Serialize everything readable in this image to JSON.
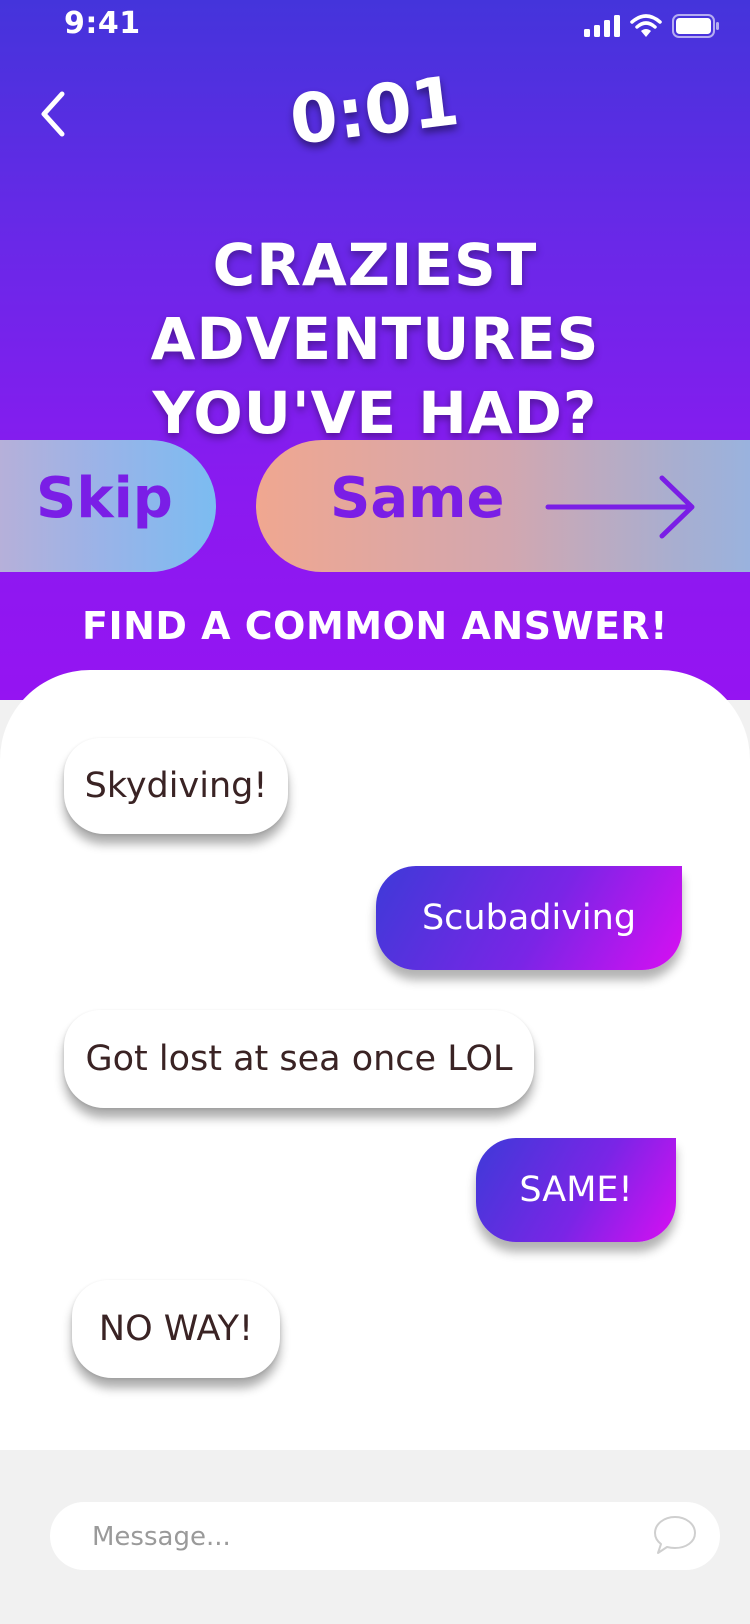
{
  "status_bar": {
    "time": "9:41"
  },
  "timer": "0:01",
  "question": {
    "line1": "CRAZIEST ADVENTURES",
    "line2": "YOU'VE HAD?"
  },
  "actions": {
    "skip": "Skip",
    "same": "Same"
  },
  "hint": "FIND A COMMON ANSWER!",
  "messages": [
    {
      "from": "them",
      "text": "Skydiving!"
    },
    {
      "from": "me",
      "text": "Scubadiving"
    },
    {
      "from": "them",
      "text": "Got lost at sea once LOL"
    },
    {
      "from": "me",
      "text": "SAME!"
    },
    {
      "from": "them",
      "text": "NO WAY!"
    }
  ],
  "composer": {
    "placeholder": "Message..."
  },
  "icons": {
    "back": "chevron-left-icon",
    "arrow": "arrow-right-icon",
    "chat": "chat-bubble-icon",
    "signal": "cellular-signal-icon",
    "wifi": "wifi-icon",
    "battery": "battery-icon"
  },
  "colors": {
    "accent": "#7a1ee6",
    "header_top": "#4434db",
    "header_bottom": "#9514f2",
    "bubble_out_start": "#3e3ad8",
    "bubble_out_end": "#d80ff2"
  }
}
